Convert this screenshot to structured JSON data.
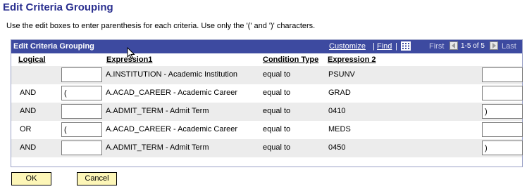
{
  "page_title": "Edit Criteria Grouping",
  "instructions": "Use the edit boxes to enter parenthesis for each criteria. Use only the '(' and ')' characters.",
  "grid": {
    "title": "Edit Criteria Grouping",
    "customize": "Customize",
    "find": "Find",
    "sep": "|",
    "first": "First",
    "range": "1-5 of 5",
    "last": "Last",
    "columns": {
      "logical": "Logical",
      "expression1": "Expression1",
      "condition_type": "Condition Type",
      "expression2": "Expression 2"
    },
    "rows": [
      {
        "logical": "",
        "open": "",
        "expression1": "A.INSTITUTION - Academic Institution",
        "condition": "equal to",
        "expression2": "PSUNV",
        "close": ""
      },
      {
        "logical": "AND",
        "open": "(",
        "expression1": "A.ACAD_CAREER - Academic Career",
        "condition": "equal to",
        "expression2": "GRAD",
        "close": ""
      },
      {
        "logical": "AND",
        "open": "",
        "expression1": "A.ADMIT_TERM - Admit Term",
        "condition": "equal to",
        "expression2": "0410",
        "close": ")"
      },
      {
        "logical": "OR",
        "open": "(",
        "expression1": "A.ACAD_CAREER - Academic Career",
        "condition": "equal to",
        "expression2": "MEDS",
        "close": ""
      },
      {
        "logical": "AND",
        "open": "",
        "expression1": "A.ADMIT_TERM - Admit Term",
        "condition": "equal to",
        "expression2": "0450",
        "close": ")"
      }
    ]
  },
  "buttons": {
    "ok": "OK",
    "cancel": "Cancel"
  },
  "colors": {
    "header_bg": "#3d4aa0",
    "title": "#2a2f8f",
    "button_bg": "#fdf6b7",
    "row_shade": "#ececec"
  },
  "icons": {
    "grid_view": "grid-view-icon",
    "prev": "arrow-left-icon",
    "next": "arrow-right-icon",
    "cursor": "mouse-cursor-icon"
  }
}
